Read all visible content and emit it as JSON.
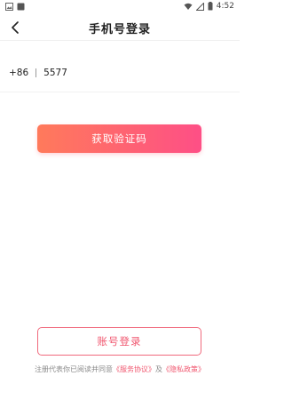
{
  "status_bar": {
    "time": "4:52",
    "left_icons": [
      "image-icon",
      "notification-icon"
    ],
    "right_icons": [
      "wifi-icon",
      "signal-icon",
      "battery-icon"
    ]
  },
  "header": {
    "title": "手机号登录",
    "back_icon": "back-arrow-icon"
  },
  "phone": {
    "country_code": "+86",
    "value": "5577"
  },
  "buttons": {
    "get_code": "获取验证码",
    "account_login": "账号登录"
  },
  "agreement": {
    "prefix": "注册代表你已阅读并同意",
    "service_link": "《服务协议》",
    "conjunction": "及",
    "privacy_link": "《隐私政策》"
  },
  "colors": {
    "accent_start": "#ff7a5b",
    "accent_end": "#fe4f86",
    "accent_text": "#f0576f"
  }
}
